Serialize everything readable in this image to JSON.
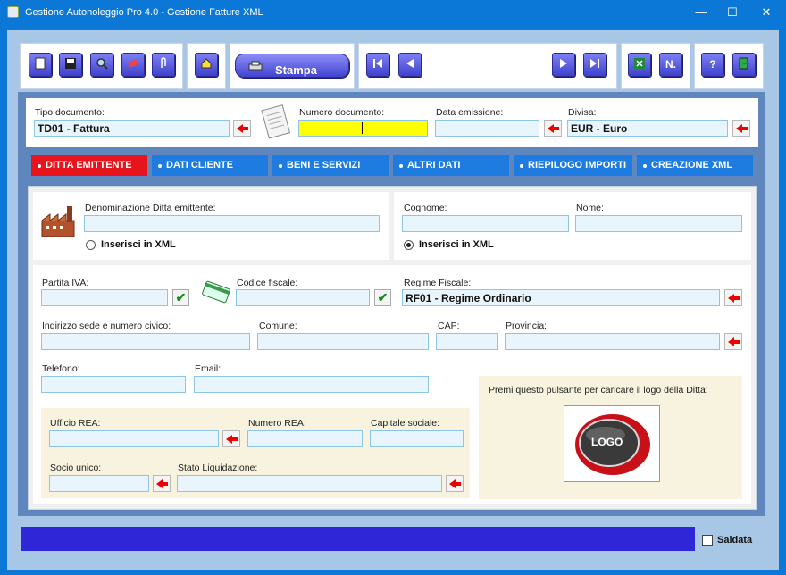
{
  "window": {
    "title": "Gestione Autonoleggio Pro 4.0 - Gestione Fatture XML",
    "minimize": "—",
    "maximize": "☐",
    "close": "✕"
  },
  "toolbar": {
    "print_label": "Stampa",
    "n_label": "N.",
    "help_label": "?"
  },
  "document": {
    "tipo_label": "Tipo documento:",
    "tipo_value": "TD01 - Fattura",
    "numero_label": "Numero documento:",
    "numero_value": "",
    "data_label": "Data emissione:",
    "data_value": "",
    "divisa_label": "Divisa:",
    "divisa_value": "EUR - Euro"
  },
  "tabs": [
    "DITTA EMITTENTE",
    "DATI CLIENTE",
    "BENI E SERVIZI",
    "ALTRI DATI",
    "RIEPILOGO IMPORTI",
    "CREAZIONE XML"
  ],
  "ditta": {
    "denominazione_label": "Denominazione Ditta emittente:",
    "inserisci_label": "Inserisci in XML",
    "cognome_label": "Cognome:",
    "nome_label": "Nome:",
    "inserisci_label2": "Inserisci in XML",
    "piva_label": "Partita IVA:",
    "cf_label": "Codice fiscale:",
    "regime_label": "Regime Fiscale:",
    "regime_value": "RF01 - Regime Ordinario",
    "indirizzo_label": "Indirizzo sede e numero civico:",
    "comune_label": "Comune:",
    "cap_label": "CAP:",
    "provincia_label": "Provincia:",
    "telefono_label": "Telefono:",
    "email_label": "Email:",
    "ufficio_rea_label": "Ufficio REA:",
    "numero_rea_label": "Numero REA:",
    "capitale_label": "Capitale sociale:",
    "socio_label": "Socio unico:",
    "liquidazione_label": "Stato Liquidazione:",
    "logo_prompt": "Premi questo pulsante per caricare il logo della Ditta:",
    "logo_text": "LOGO"
  },
  "footer": {
    "saldata_label": "Saldata"
  }
}
